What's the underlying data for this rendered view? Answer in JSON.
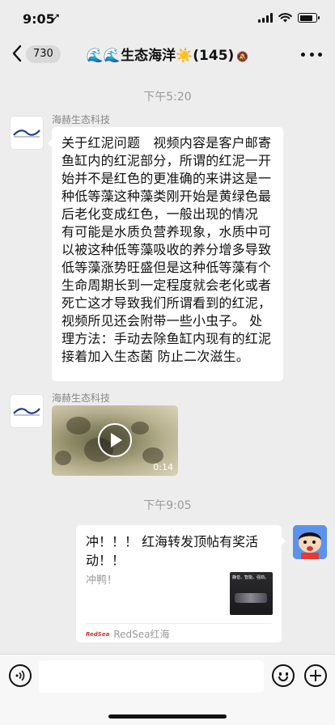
{
  "status_bar": {
    "time": "9:05",
    "location_icon": "location-arrow-icon",
    "battery_level": 0.8
  },
  "nav": {
    "back_icon": "chevron-left-icon",
    "unread_count": "730",
    "title_prefix": "🌊🌊",
    "title_main": "生态海洋",
    "title_emoji": "☀️",
    "title_count": "(145)",
    "mute_icon": "bell-slash-icon",
    "more_icon": "more-dots-icon"
  },
  "messages": {
    "time_1": "下午5:20",
    "sender_1": "海赫生态科技",
    "text_1": "关于红泥问题　视频内容是客户邮寄鱼缸内的红泥部分，所谓的红泥一开始并不是红色的更准确的来讲这是一种低等藻这种藻类刚开始是黄绿色最后老化变成红色，一般出现的情况 有可能是水质负营养现象，水质中可以被这种低等藻吸收的养分增多导致低等藻涨势旺盛但是这种低等藻有个生命周期长到一定程度就会老化或者死亡这才导致我们所谓看到的红泥，视频所见还会附带一些小虫子。 处理方法：手动去除鱼缸内现有的红泥接着加入生态菌 防止二次滋生。",
    "sender_2": "海赫生态科技",
    "video_duration": "0:14",
    "time_2": "下午9:05",
    "card": {
      "title": "冲！！！ 红海转发顶帖有奖活动！！",
      "desc": "冲鸭！",
      "thumb_caption": "静音。智能。强劲。",
      "source_logo": "RedSea",
      "source": "RedSea红海"
    }
  },
  "input_bar": {
    "voice_icon": "voice-icon",
    "emoji_icon": "emoji-icon",
    "plus_icon": "plus-icon"
  }
}
